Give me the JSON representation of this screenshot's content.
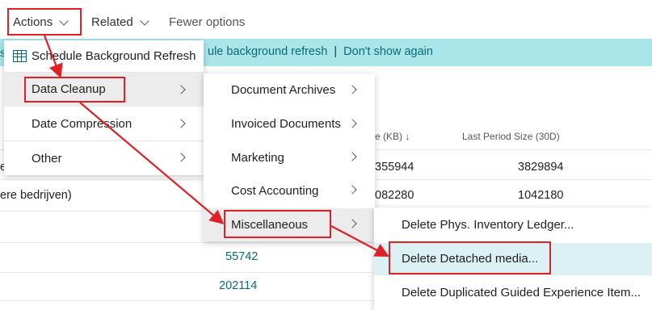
{
  "actionbar": {
    "actions_label": "Actions",
    "related_label": "Related",
    "fewer_label": "Fewer options"
  },
  "banner": {
    "stub": "s",
    "text": "ule background refresh",
    "separator": "|",
    "dont_show": "Don't show again"
  },
  "list": {
    "header_size": "e (KB) ↓",
    "header_last": "Last Period Size (30D)",
    "rows": [
      {
        "name": "e",
        "size": "355944",
        "last": "3829894"
      },
      {
        "name": "ere bedrijven)",
        "size": "082280",
        "last": "1042180"
      },
      {
        "name": "",
        "size": "",
        "last": ""
      },
      {
        "name": "",
        "size": "55742",
        "last": ""
      },
      {
        "name": "",
        "size": "202114",
        "last": ""
      }
    ]
  },
  "menu1": {
    "items": [
      "Schedule Background Refresh",
      "Data Cleanup",
      "Date Compression",
      "Other"
    ]
  },
  "menu2": {
    "items": [
      "Document Archives",
      "Invoiced Documents",
      "Marketing",
      "Cost Accounting",
      "Miscellaneous"
    ]
  },
  "menu3": {
    "items": [
      "Delete Phys. Inventory Ledger...",
      "Delete Detached media...",
      "Delete Duplicated Guided Experience Item..."
    ]
  },
  "colors": {
    "annotation": "#e01f26",
    "link": "#0a6a75",
    "banner": "#aae5e9"
  }
}
